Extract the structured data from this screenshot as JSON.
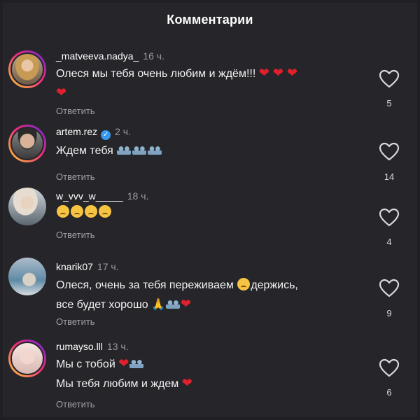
{
  "header": {
    "title": "Комментарии"
  },
  "comments": [
    {
      "username": "_matveeva.nadya_",
      "time": "16 ч.",
      "line1": "Олеся мы тебя очень любим и ждём!!!",
      "line1_emoji": "❤️❤️❤️",
      "line2_emoji": "❤️",
      "reply": "Ответить",
      "likes": "5"
    },
    {
      "username": "artem.rez",
      "verified": true,
      "time": "2 ч.",
      "line1": "Ждем тебя",
      "line1_emoji": "🫂🫂🫂",
      "reply": "Ответить",
      "likes": "14"
    },
    {
      "username": "w_vvv_w_____",
      "time": "18 ч.",
      "line1_emoji": "😢😢😢😢",
      "reply": "Ответить",
      "likes": "4"
    },
    {
      "username": "knarik07",
      "time": "17 ч.",
      "line1": "Олеся, очень за тебя переживаем",
      "line1_emoji": "🥺",
      "line1_after": "держись,",
      "line2": "все будет хорошо",
      "line2_emoji": "🙏🫂❤️",
      "reply": "Ответить",
      "likes": "9"
    },
    {
      "username": "rumayso.lll",
      "time": "13 ч.",
      "line1": "Мы с тобой",
      "line1_emoji": "❤️🫂",
      "line2": "Мы тебя любим и ждем",
      "line2_emoji": "❤️",
      "reply": "Ответить",
      "likes": "6"
    }
  ],
  "colors": {
    "background": "#25252a",
    "heart": "#e0202c",
    "verified": "#3897f0"
  },
  "icons": {
    "like": "heart-outline-icon"
  }
}
